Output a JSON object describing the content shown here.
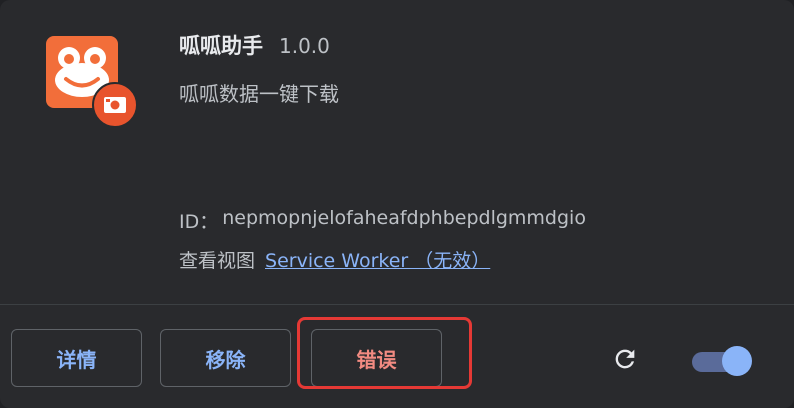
{
  "extension": {
    "name": "呱呱助手",
    "version": "1.0.0",
    "description": "呱呱数据一键下载",
    "id_label": "ID：",
    "id_value": "nepmopnjelofaheafdphbepdlgmmdgio",
    "inspect_label": "查看视图",
    "service_worker_link": "Service Worker （无效）"
  },
  "actions": {
    "details_label": "详情",
    "remove_label": "移除",
    "errors_label": "错误"
  },
  "controls": {
    "reload_icon": "reload-icon",
    "toggle_enabled": true
  },
  "colors": {
    "icon_orange": "#F26E3A",
    "accent_blue": "#8ab4f8",
    "error_red": "#f28b82",
    "highlight_red": "#e53935"
  }
}
